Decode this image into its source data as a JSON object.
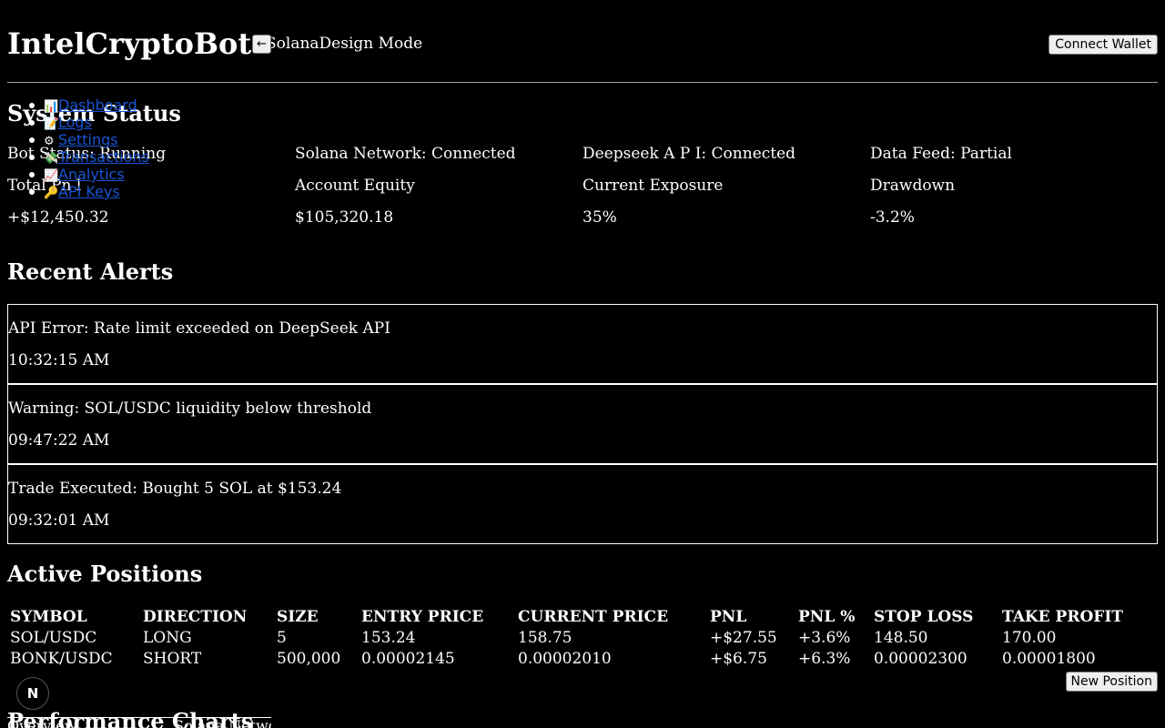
{
  "header": {
    "app_title": "IntelCryptoBot",
    "back_glyph": "←",
    "network_text": "SolanaDesign Mode",
    "connect_wallet": "Connect Wallet"
  },
  "nav": {
    "items": [
      {
        "icon": "📊",
        "icon_name": "bar-chart-icon",
        "label": "Dashboard"
      },
      {
        "icon": "📝",
        "icon_name": "memo-icon",
        "label": "Logs"
      },
      {
        "icon": "⚙",
        "icon_name": "gear-icon",
        "label": "Settings"
      },
      {
        "icon": "💸",
        "icon_name": "money-icon",
        "label": "Transactions"
      },
      {
        "icon": "📈",
        "icon_name": "trend-up-icon",
        "label": "Analytics"
      },
      {
        "icon": "🔑",
        "icon_name": "key-icon",
        "label": "API Keys"
      }
    ]
  },
  "system_status": {
    "title": "System Status",
    "row1": [
      "Bot Status: Running",
      "Solana Network: Connected",
      "Deepseek A P I: Connected",
      "Data Feed: Partial"
    ],
    "labels": [
      "Total Pn l",
      "Account Equity",
      "Current Exposure",
      "Drawdown"
    ],
    "values": [
      "+$12,450.32",
      "$105,320.18",
      "35%",
      "-3.2%"
    ]
  },
  "alerts": {
    "title": "Recent Alerts",
    "items": [
      {
        "message": "API Error: Rate limit exceeded on DeepSeek API",
        "time": "10:32:15 AM"
      },
      {
        "message": "Warning: SOL/USDC liquidity below threshold",
        "time": "09:47:22 AM"
      },
      {
        "message": "Trade Executed: Bought 5 SOL at $153.24",
        "time": "09:32:01 AM"
      }
    ]
  },
  "positions": {
    "title": "Active Positions",
    "columns": [
      "SYMBOL",
      "DIRECTION",
      "SIZE",
      "ENTRY PRICE",
      "CURRENT PRICE",
      "PNL",
      "PNL %",
      "STOP LOSS",
      "TAKE PROFIT"
    ],
    "rows": [
      [
        "SOL/USDC",
        "LONG",
        "5",
        "153.24",
        "158.75",
        "+$27.55",
        "+3.6%",
        "148.50",
        "170.00"
      ],
      [
        "BONK/USDC",
        "SHORT",
        "500,000",
        "0.00002145",
        "0.00002010",
        "+$6.75",
        "+6.3%",
        "0.00002300",
        "0.00001800"
      ]
    ],
    "new_position": "New Position"
  },
  "badge": {
    "letter": "N"
  },
  "performance": {
    "title": "Performance Charts",
    "tabs": [
      "Overview",
      "Solana Network"
    ]
  }
}
